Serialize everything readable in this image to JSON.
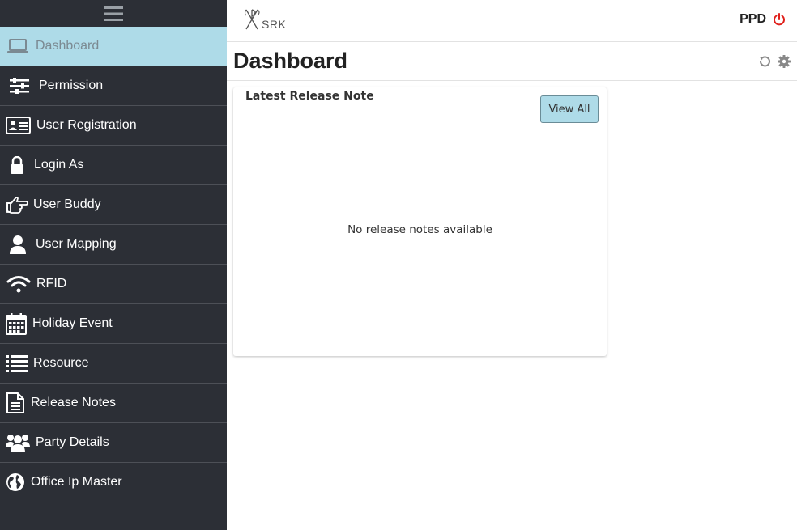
{
  "brand": {
    "logo_text": "SRK"
  },
  "user": {
    "name": "PPD",
    "power_color": "#e0201b"
  },
  "page": {
    "title": "Dashboard"
  },
  "sidebar": {
    "active_color": "#aedbe8",
    "items": [
      {
        "label": "Dashboard",
        "icon": "laptop-icon"
      },
      {
        "label": "Permission",
        "icon": "sliders-icon"
      },
      {
        "label": "User Registration",
        "icon": "id-card-icon"
      },
      {
        "label": "Login As",
        "icon": "lock-icon"
      },
      {
        "label": "User Buddy",
        "icon": "hand-pointing-icon"
      },
      {
        "label": "User Mapping",
        "icon": "user-icon"
      },
      {
        "label": "RFID",
        "icon": "wifi-icon"
      },
      {
        "label": "Holiday Event",
        "icon": "calendar-icon"
      },
      {
        "label": "Resource",
        "icon": "list-icon"
      },
      {
        "label": "Release Notes",
        "icon": "document-icon"
      },
      {
        "label": "Party Details",
        "icon": "users-icon"
      },
      {
        "label": "Office Ip Master",
        "icon": "globe-icon"
      }
    ]
  },
  "release_card": {
    "title": "Latest Release Note",
    "view_all_label": "View All",
    "empty_message": "No release notes available"
  }
}
